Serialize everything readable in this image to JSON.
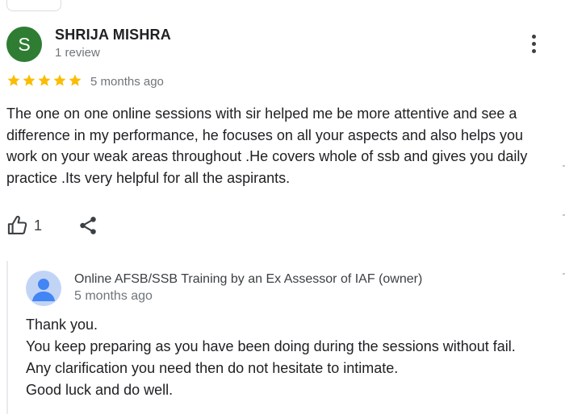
{
  "review": {
    "avatar_initial": "S",
    "reviewer_name": "SHRIJA MISHRA",
    "review_count": "1 review",
    "rating": 5,
    "rating_max": 5,
    "time_ago": "5 months ago",
    "text": "The one on one online sessions with sir helped me be more attentive and see a difference in my performance, he focuses on all your aspects and also helps you work on your weak areas throughout .He covers whole of ssb and gives you daily practice .Its very helpful for all the aspirants.",
    "like_count": "1"
  },
  "owner_reply": {
    "owner_name": "Online AFSB/SSB Training by an Ex Assessor of IAF (owner)",
    "time_ago": "5 months ago",
    "lines": [
      "Thank you.",
      "You keep preparing as you have been doing during the sessions without fail.",
      "Any clarification you need then do not hesitate to intimate.",
      "Good luck and do well."
    ]
  },
  "colors": {
    "star": "#fbbc04",
    "avatar_bg": "#2e7d32",
    "owner_avatar_bg": "#c2d4f6",
    "owner_avatar_fg": "#4285f4"
  },
  "icons": {
    "more": "more-vert-icon",
    "star": "star-icon",
    "like": "thumb-up-icon",
    "share": "share-icon",
    "owner_avatar": "default-person-avatar-icon"
  }
}
